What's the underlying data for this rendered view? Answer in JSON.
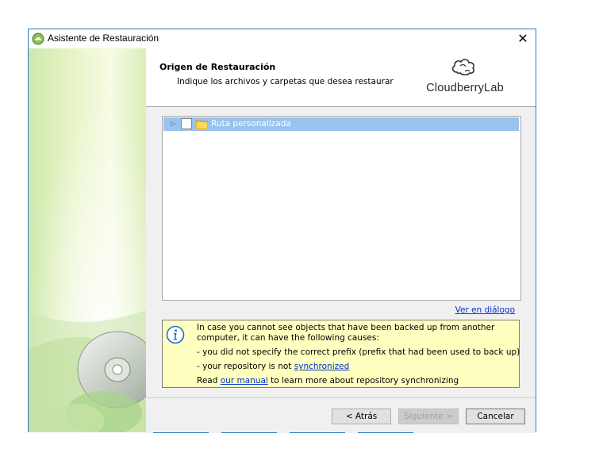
{
  "window": {
    "title": "Asistente de Restauración",
    "close_glyph": "✕"
  },
  "header": {
    "title": "Origen de Restauración",
    "subtitle": "Indique los archivos y carpetas que desea restaurar",
    "logo_text": "CloudberryLab"
  },
  "tree": {
    "items": [
      {
        "label": "Ruta personalizada",
        "expander": "▷",
        "checked": false,
        "icon": "folder-icon"
      }
    ]
  },
  "links": {
    "ver_en_dialogo": "Ver en diálogo"
  },
  "info": {
    "icon": "info-icon",
    "line1": "In case you cannot see objects that have been backed up from another",
    "line2": "computer, it can have the following causes:",
    "line3": "- you did not specify the correct prefix (prefix that had been used to back up)",
    "line4_prefix": "- your repository is not ",
    "line4_link": "synchronized",
    "line5_prefix": "Read ",
    "line5_link": "our manual",
    "line5_suffix": " to learn more about repository synchronizing"
  },
  "footer": {
    "back_label": "< Atrás",
    "next_label": "Siguiente >",
    "cancel_label": "Cancelar"
  },
  "colors": {
    "selection": "#99c2ee",
    "info_background": "#ffffc0",
    "link": "#0033cc",
    "window_border": "#2b79c2"
  }
}
